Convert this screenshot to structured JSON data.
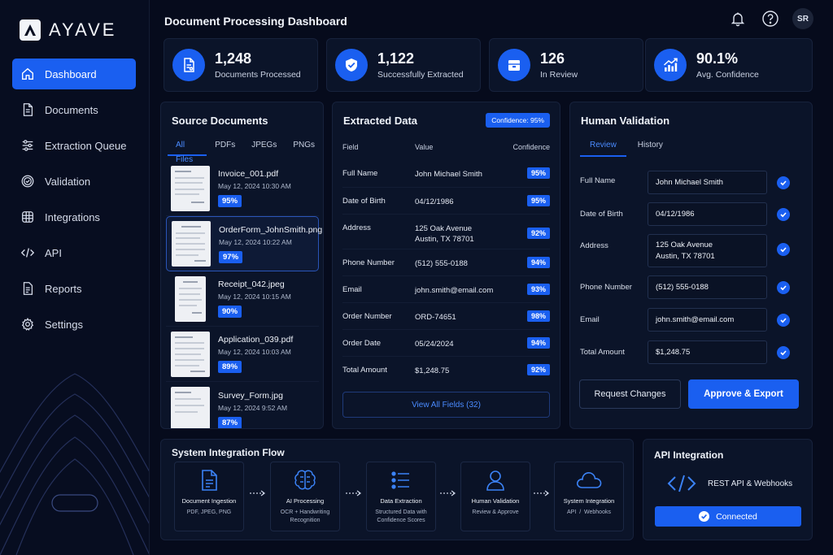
{
  "brand": {
    "name": "AYAVE"
  },
  "header": {
    "title": "Document Processing Dashboard",
    "avatar_initials": "SR"
  },
  "sidebar": {
    "items": [
      {
        "label": "Dashboard",
        "icon": "home-icon",
        "active": true
      },
      {
        "label": "Documents",
        "icon": "document-icon"
      },
      {
        "label": "Extraction Queue",
        "icon": "sliders-icon"
      },
      {
        "label": "Validation",
        "icon": "check-circle-icon"
      },
      {
        "label": "Integrations",
        "icon": "grid-icon"
      },
      {
        "label": "API",
        "icon": "code-icon"
      },
      {
        "label": "Reports",
        "icon": "report-icon"
      },
      {
        "label": "Settings",
        "icon": "gear-icon"
      }
    ]
  },
  "stats": [
    {
      "value": "1,248",
      "label": "Documents Processed",
      "icon": "document-icon"
    },
    {
      "value": "1,122",
      "label": "Successfully Extracted",
      "icon": "check-shield-icon"
    },
    {
      "value": "126",
      "label": "In Review",
      "icon": "inbox-icon"
    },
    {
      "value": "90.1%",
      "label": "Avg. Confidence",
      "icon": "chart-up-icon"
    }
  ],
  "source": {
    "title": "Source Documents",
    "tabs": [
      "All Files",
      "PDFs",
      "JPEGs",
      "PNGs"
    ],
    "docs": [
      {
        "name": "Invoice_001.pdf",
        "date": "May 12, 2024 10:30 AM",
        "conf": "95%"
      },
      {
        "name": "OrderForm_JohnSmith.png",
        "date": "May 12, 2024 10:22 AM",
        "conf": "97%"
      },
      {
        "name": "Receipt_042.jpeg",
        "date": "May 12, 2024 10:15 AM",
        "conf": "90%"
      },
      {
        "name": "Application_039.pdf",
        "date": "May 12, 2024 10:03 AM",
        "conf": "89%"
      },
      {
        "name": "Survey_Form.jpg",
        "date": "May 12, 2024 9:52 AM",
        "conf": "87%"
      }
    ]
  },
  "extracted": {
    "title": "Extracted Data",
    "confidence_tag": "Confidence: 95%",
    "headers": {
      "field": "Field",
      "value": "Value",
      "confidence": "Confidence"
    },
    "rows": [
      {
        "field": "Full Name",
        "value": "John Michael Smith",
        "conf": "95%"
      },
      {
        "field": "Date of Birth",
        "value": "04/12/1986",
        "conf": "95%"
      },
      {
        "field": "Address",
        "value": "125 Oak Avenue",
        "value2": "Austin, TX 78701",
        "conf": "92%"
      },
      {
        "field": "Phone Number",
        "value": "(512) 555-0188",
        "conf": "94%"
      },
      {
        "field": "Email",
        "value": "john.smith@email.com",
        "conf": "93%"
      },
      {
        "field": "Order Number",
        "value": "ORD-74651",
        "conf": "98%"
      },
      {
        "field": "Order Date",
        "value": "05/24/2024",
        "conf": "94%"
      },
      {
        "field": "Total Amount",
        "value": "$1,248.75",
        "conf": "92%"
      }
    ],
    "view_all": "View All Fields (32)"
  },
  "validation": {
    "title": "Human Validation",
    "tabs": [
      "Review",
      "History"
    ],
    "rows": [
      {
        "label": "Full Name",
        "value": "John Michael Smith"
      },
      {
        "label": "Date of Birth",
        "value": "04/12/1986"
      },
      {
        "label": "Address",
        "value": "125 Oak Avenue",
        "value2": "Austin, TX 78701"
      },
      {
        "label": "Phone Number",
        "value": "(512) 555-0188"
      },
      {
        "label": "Email",
        "value": "john.smith@email.com"
      },
      {
        "label": "Total Amount",
        "value": "$1,248.75"
      }
    ],
    "request_changes": "Request Changes",
    "approve": "Approve & Export"
  },
  "flow": {
    "title": "System Integration Flow",
    "steps": [
      {
        "title": "Document Ingestion",
        "desc": "PDF, JPEG, PNG",
        "icon": "document-icon"
      },
      {
        "title": "AI Processing",
        "desc": "OCR + Handwriting",
        "desc2": "Recognition",
        "icon": "brain-icon"
      },
      {
        "title": "Data Extraction",
        "desc": "Structured Data with",
        "desc2": "Confidence Scores",
        "icon": "list-icon"
      },
      {
        "title": "Human Validation",
        "desc": "Review & Approve",
        "icon": "user-icon"
      },
      {
        "title": "System Integration",
        "desc": "API  /  Webhooks",
        "icon": "cloud-icon"
      }
    ]
  },
  "api": {
    "title": "API Integration",
    "label": "REST API & Webhooks",
    "status": "Connected"
  },
  "colors": {
    "accent": "#1a5ff0",
    "background": "#060b1c",
    "card": "#0b1429"
  }
}
